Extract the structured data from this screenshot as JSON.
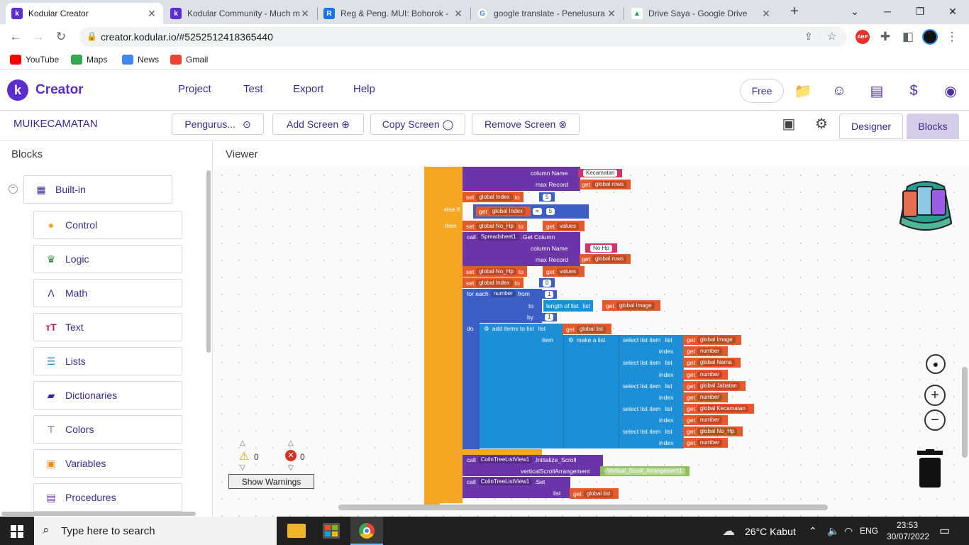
{
  "browser": {
    "tabs": [
      {
        "title": "Kodular Creator",
        "favicon_color": "#5a2dcc",
        "glyph": "k"
      },
      {
        "title": "Kodular Community - Much m",
        "favicon_color": "#5a2dcc",
        "glyph": "k"
      },
      {
        "title": "Reg & Peng. MUI: Bohorok -",
        "favicon_color": "#1a73e8",
        "glyph": "R"
      },
      {
        "title": "google translate - Penelusura",
        "favicon_color": "#ffffff",
        "glyph": "G"
      },
      {
        "title": "Drive Saya - Google Drive",
        "favicon_color": "#ffffff",
        "glyph": "▲"
      }
    ],
    "new_tab": "+",
    "url": "creator.kodular.io/#5252512418365440",
    "bookmarks": [
      "YouTube",
      "Maps",
      "News",
      "Gmail"
    ]
  },
  "app": {
    "name": "Creator",
    "menu": [
      "Project",
      "Test",
      "Export",
      "Help"
    ],
    "plan": "Free",
    "project_name": "MUIKECAMATAN",
    "screen_select": "Pengurus...",
    "add_screen": "Add Screen",
    "copy_screen": "Copy Screen",
    "remove_screen": "Remove Screen",
    "designer": "Designer",
    "blocks": "Blocks"
  },
  "blocks_panel": {
    "title": "Blocks",
    "builtin": "Built-in",
    "items": [
      {
        "label": "Control",
        "icon": "control-icon",
        "color": "#f5a623"
      },
      {
        "label": "Logic",
        "icon": "logic-icon",
        "color": "#2e7d32"
      },
      {
        "label": "Math",
        "icon": "math-icon",
        "color": "#3d2a8e"
      },
      {
        "label": "Text",
        "icon": "text-icon",
        "color": "#c2185b"
      },
      {
        "label": "Lists",
        "icon": "lists-icon",
        "color": "#1c8fd6"
      },
      {
        "label": "Dictionaries",
        "icon": "dictionaries-icon",
        "color": "#3d2a8e"
      },
      {
        "label": "Colors",
        "icon": "colors-icon",
        "color": "#555555"
      },
      {
        "label": "Variables",
        "icon": "variables-icon",
        "color": "#f08c1a"
      },
      {
        "label": "Procedures",
        "icon": "procedures-icon",
        "color": "#6b34a8"
      }
    ]
  },
  "viewer": {
    "title": "Viewer",
    "warnings_count": "0",
    "errors_count": "0",
    "show_warnings": "Show Warnings",
    "blocks": {
      "column_name": "column Name",
      "max_record": "max Record",
      "val_kecamatan": "Kecamatan",
      "get": "get",
      "global_rows": "global rows",
      "set": "set",
      "global_index": "global Index",
      "to": "to",
      "num5": "5",
      "else_if": "else if",
      "eq": "=",
      "then": "then",
      "global_nohp": "global No_Hp",
      "values": "values",
      "call": "call",
      "spreadsheet": "Spreadsheet1",
      "get_column": ".Get Column",
      "val_nohp": "No Hp",
      "num0": "0",
      "for_each": "for each",
      "number": "number",
      "from": "from",
      "num1": "1",
      "length_of_list": "length of list",
      "list": "list",
      "global_image": "global Image",
      "by": "by",
      "do": "do",
      "add_items": "add items to list",
      "global_list": "global list",
      "item": "item",
      "make_a_list": "make a list",
      "select_list_item": "select list item",
      "index": "index",
      "global_nama": "global Nama",
      "global_jabatan": "global Jabatan",
      "global_kecamatan": "global Kecamatan",
      "colin": "ColinTreeListView1",
      "initialize_scroll": ".Initialize_Scroll",
      "vsa": "verticalScrollArrangement",
      "vsa_val": "Vertical_Scroll_Arrangement1",
      "set_method": ".Set"
    }
  },
  "taskbar": {
    "search_placeholder": "Type here to search",
    "weather": "26°C  Kabut",
    "lang": "ENG",
    "time": "23:53",
    "date": "30/07/2022"
  }
}
